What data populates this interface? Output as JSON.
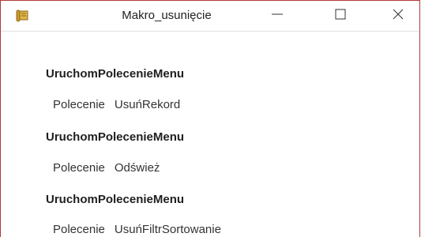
{
  "window": {
    "title": "Makro_usunięcie",
    "icon": "macro-scroll-icon",
    "controls": {
      "minimize": "minimize-icon",
      "maximize": "maximize-icon",
      "close": "close-icon"
    },
    "accent_border": "#b03a3a"
  },
  "macro": {
    "actions": [
      {
        "name": "UruchomPolecenieMenu",
        "arg_label": "Polecenie",
        "arg_value": "UsuńRekord"
      },
      {
        "name": "UruchomPolecenieMenu",
        "arg_label": "Polecenie",
        "arg_value": "Odśwież"
      },
      {
        "name": "UruchomPolecenieMenu",
        "arg_label": "Polecenie",
        "arg_value": "UsuńFiltrSortowanie"
      }
    ]
  }
}
